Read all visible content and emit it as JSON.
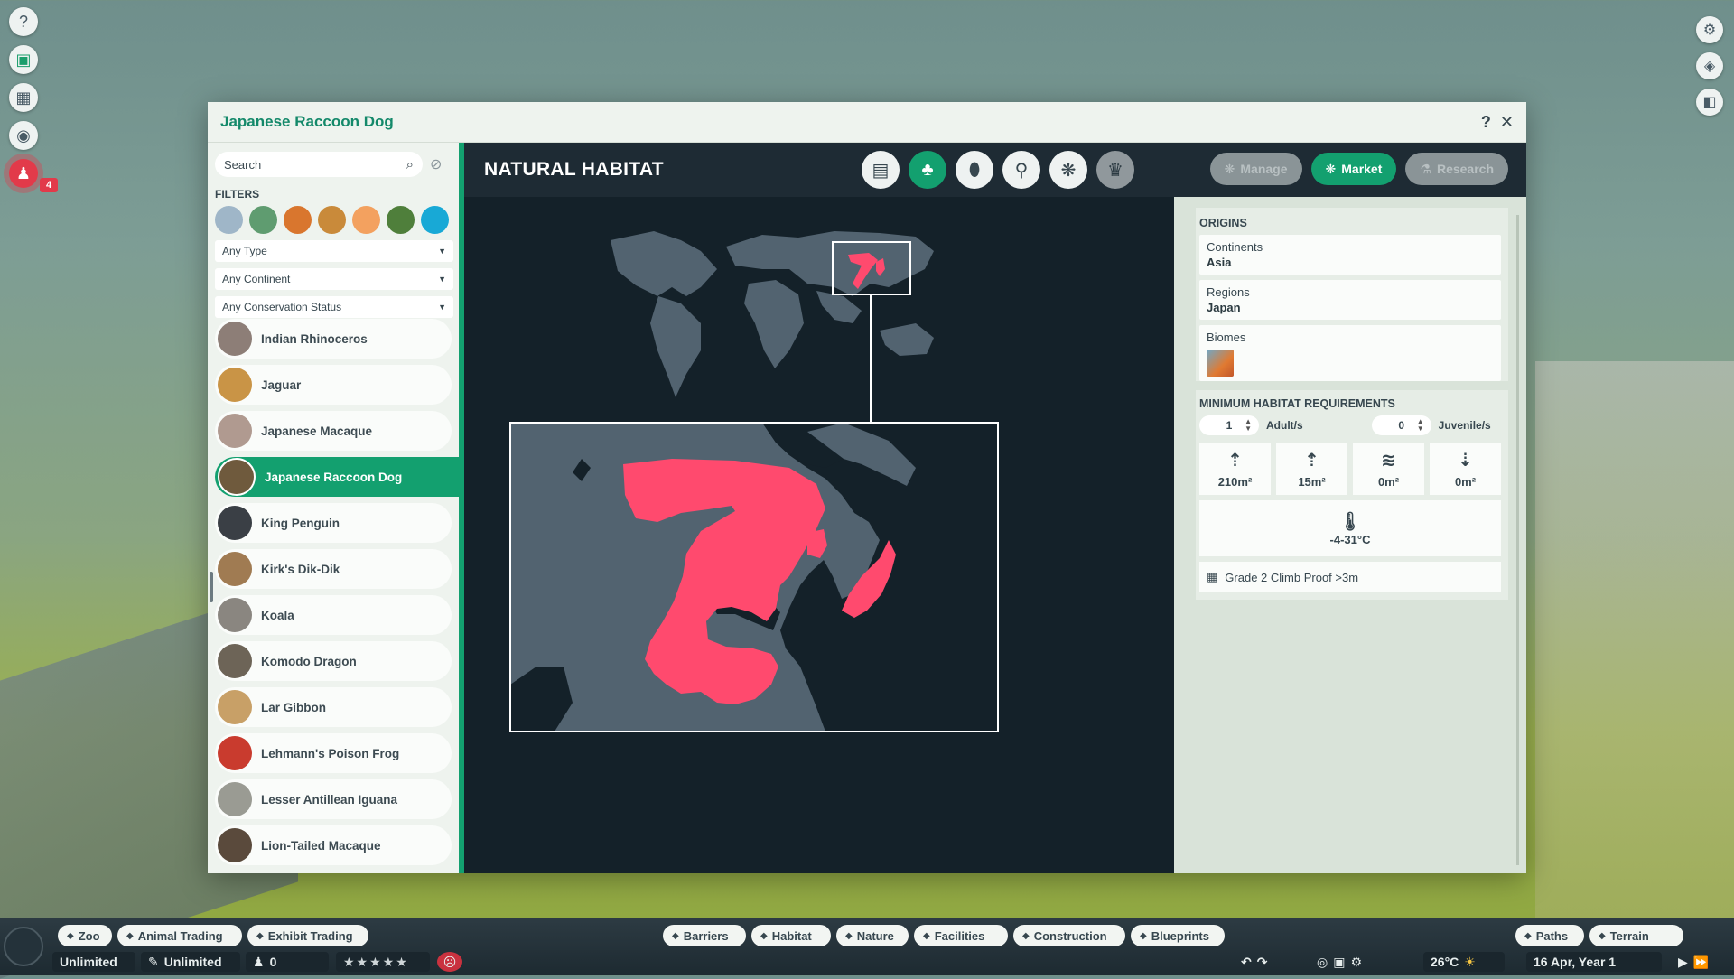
{
  "window": {
    "title": "Japanese Raccoon Dog",
    "help": "?",
    "close": "✕"
  },
  "sidebar": {
    "search_placeholder": "Search",
    "filters_label": "FILTERS",
    "biome_colors": [
      "#9fb6c8",
      "#5f9c70",
      "#d9762e",
      "#c98a3a",
      "#f3a15f",
      "#4f7f3b",
      "#18a9d6"
    ],
    "dropdowns": [
      "Any Type",
      "Any Continent",
      "Any Conservation Status"
    ],
    "animals": [
      {
        "name": "Indian Rhinoceros",
        "color": "#8d7e77"
      },
      {
        "name": "Jaguar",
        "color": "#c99446"
      },
      {
        "name": "Japanese Macaque",
        "color": "#b09a90"
      },
      {
        "name": "Japanese Raccoon Dog",
        "color": "#6f5a3d",
        "selected": true
      },
      {
        "name": "King Penguin",
        "color": "#3a3f45"
      },
      {
        "name": "Kirk's Dik-Dik",
        "color": "#a07b52"
      },
      {
        "name": "Koala",
        "color": "#8a8680"
      },
      {
        "name": "Komodo Dragon",
        "color": "#6d6457"
      },
      {
        "name": "Lar Gibbon",
        "color": "#c8a067"
      },
      {
        "name": "Lehmann's Poison Frog",
        "color": "#c93b2e"
      },
      {
        "name": "Lesser Antillean Iguana",
        "color": "#9a9b93"
      },
      {
        "name": "Lion-Tailed Macaque",
        "color": "#5a4a3c"
      }
    ]
  },
  "content": {
    "header": "NATURAL HABITAT",
    "tabs": [
      "clipboard-icon",
      "habitat-icon",
      "water-drop-icon",
      "enrichment-icon",
      "paw-icon",
      "trophy-icon"
    ],
    "buttons": {
      "manage": "Manage",
      "market": "Market",
      "research": "Research"
    }
  },
  "origins": {
    "title": "ORIGINS",
    "continents_label": "Continents",
    "continents_value": "Asia",
    "regions_label": "Regions",
    "regions_value": "Japan",
    "biomes_label": "Biomes"
  },
  "requirements": {
    "title": "MINIMUM HABITAT REQUIREMENTS",
    "adults_value": "1",
    "adults_label": "Adult/s",
    "juveniles_value": "0",
    "juveniles_label": "Juvenile/s",
    "land": "210m²",
    "climbing": "15m²",
    "water": "0m²",
    "deep_water": "0m²",
    "temperature": "-4-31°C",
    "fence": "Grade 2 Climb Proof  >3m"
  },
  "alert_count": "4",
  "bottom": {
    "tabs_left": [
      "Zoo",
      "Animal Trading",
      "Exhibit Trading"
    ],
    "tabs_center": [
      "Barriers",
      "Habitat",
      "Nature",
      "Facilities",
      "Construction",
      "Blueprints"
    ],
    "tabs_right": [
      "Paths",
      "Terrain"
    ],
    "money": "Unlimited",
    "research": "Unlimited",
    "guests": "0",
    "rating": "★★★★★",
    "temperature": "26°C",
    "date": "16 Apr, Year 1"
  },
  "colors": {
    "accent": "#13a06f",
    "range": "#ff4a6e",
    "land": "#526370",
    "sea": "#142129"
  }
}
